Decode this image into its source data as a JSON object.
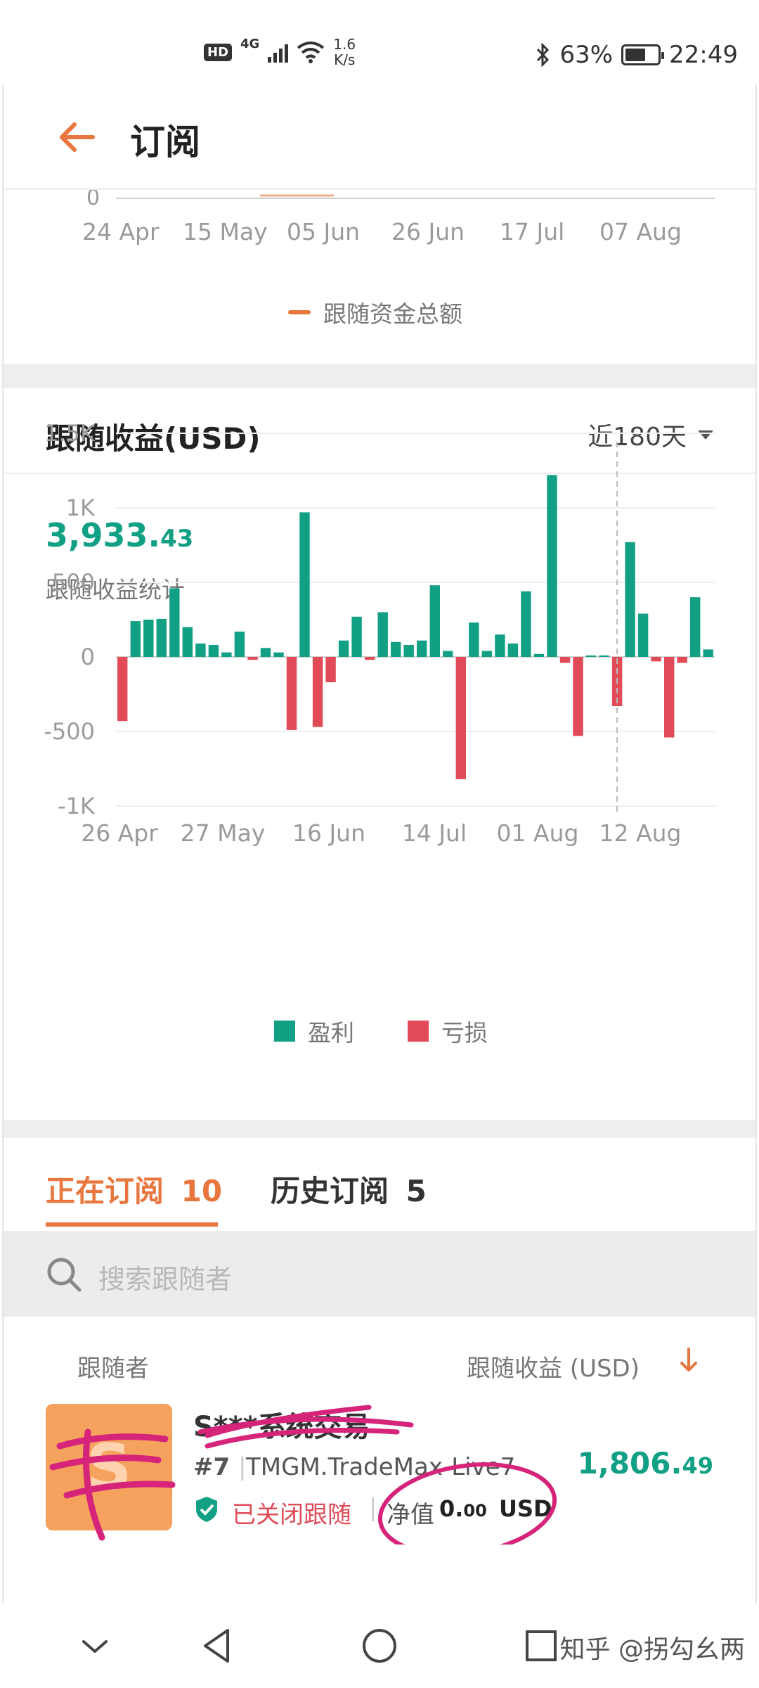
{
  "status_bar": {
    "hd": "HD",
    "network": "4G",
    "speed_value": "1.6",
    "speed_unit": "K/s",
    "battery": "63%",
    "battery_level": 0.63,
    "time": "22:49"
  },
  "header": {
    "title": "订阅",
    "back_icon": "back-arrow-icon"
  },
  "total_funds_chart": {
    "type": "area",
    "y_tick_visible": "0",
    "x_tick_labels": [
      "24 Apr",
      "15 May",
      "05 Jun",
      "26 Jun",
      "17 Jul",
      "07 Aug"
    ],
    "legend": [
      {
        "name": "跟随资金总额",
        "color": "#e8763e"
      }
    ]
  },
  "profit_section": {
    "title": "跟随收益(USD)",
    "range": "近180天",
    "total_int": "3,933.",
    "total_dec": "43",
    "total_label": "跟随收益统计"
  },
  "chart_data": {
    "type": "bar",
    "title": "",
    "xlabel": "",
    "ylabel": "",
    "ylim": [
      -1000,
      1500
    ],
    "y_ticks": [
      "1.5K",
      "1K",
      "500",
      "0",
      "-500",
      "-1K"
    ],
    "x_tick_labels": [
      "26 Apr",
      "27 May",
      "16 Jun",
      "14 Jul",
      "01 Aug",
      "12 Aug"
    ],
    "grid": true,
    "legend_position": "bottom-center",
    "series": [
      {
        "name": "盈利",
        "color": "#12a085"
      },
      {
        "name": "亏损",
        "color": "#e14b57"
      }
    ],
    "values": [
      -430,
      240,
      250,
      255,
      460,
      200,
      90,
      80,
      30,
      170,
      -20,
      60,
      30,
      -490,
      970,
      -470,
      -170,
      110,
      270,
      -20,
      300,
      100,
      80,
      110,
      480,
      40,
      -820,
      230,
      40,
      150,
      90,
      440,
      20,
      1220,
      -40,
      -530,
      10,
      10,
      -330,
      770,
      290,
      -30,
      -540,
      -40,
      400,
      50
    ]
  },
  "subscriptions": {
    "tab_active_label": "正在订阅",
    "tab_active_count": "10",
    "tab_inactive_label": "历史订阅",
    "tab_inactive_count": "5",
    "search_placeholder": "搜索跟随者",
    "col_follower": "跟随者",
    "col_profit": "跟随收益 (USD)",
    "item": {
      "name": "S***系统交易",
      "rank": "#7",
      "server": "TMGM.TradeMax-Live7",
      "status": "已关闭跟随",
      "equity_label": "净值",
      "equity_int": "0.",
      "equity_dec": "00",
      "equity_unit": "USD",
      "profit_int": "1,806.",
      "profit_dec": "49"
    }
  },
  "nav": {
    "watermark": "知乎 @拐勾幺两"
  },
  "colors": {
    "accent": "#e8763e",
    "profit": "#12a085",
    "loss": "#e14b57"
  }
}
